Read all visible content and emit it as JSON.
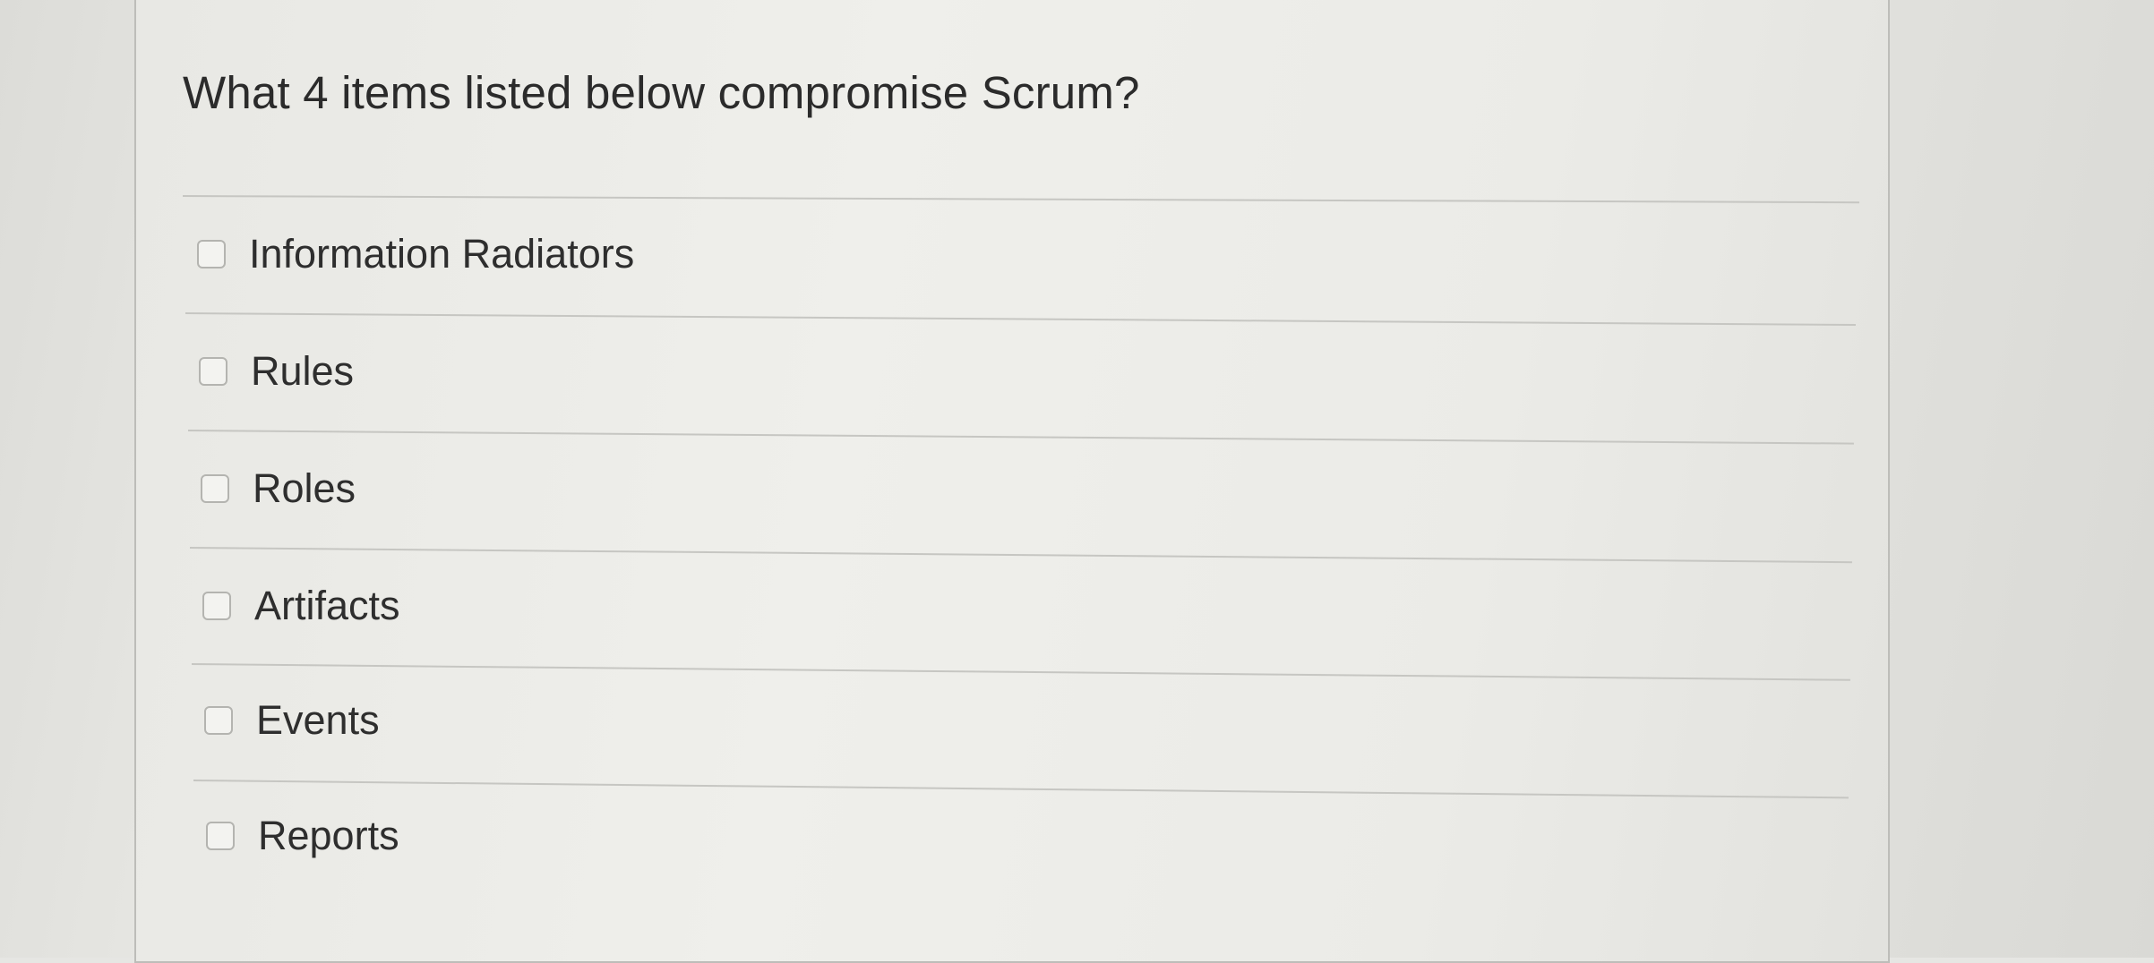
{
  "question": {
    "text": "What 4 items listed below compromise Scrum?"
  },
  "options": [
    {
      "label": "Information Radiators",
      "checked": false
    },
    {
      "label": "Rules",
      "checked": false
    },
    {
      "label": "Roles",
      "checked": false
    },
    {
      "label": "Artifacts",
      "checked": false
    },
    {
      "label": "Events",
      "checked": false
    },
    {
      "label": "Reports",
      "checked": false
    }
  ]
}
